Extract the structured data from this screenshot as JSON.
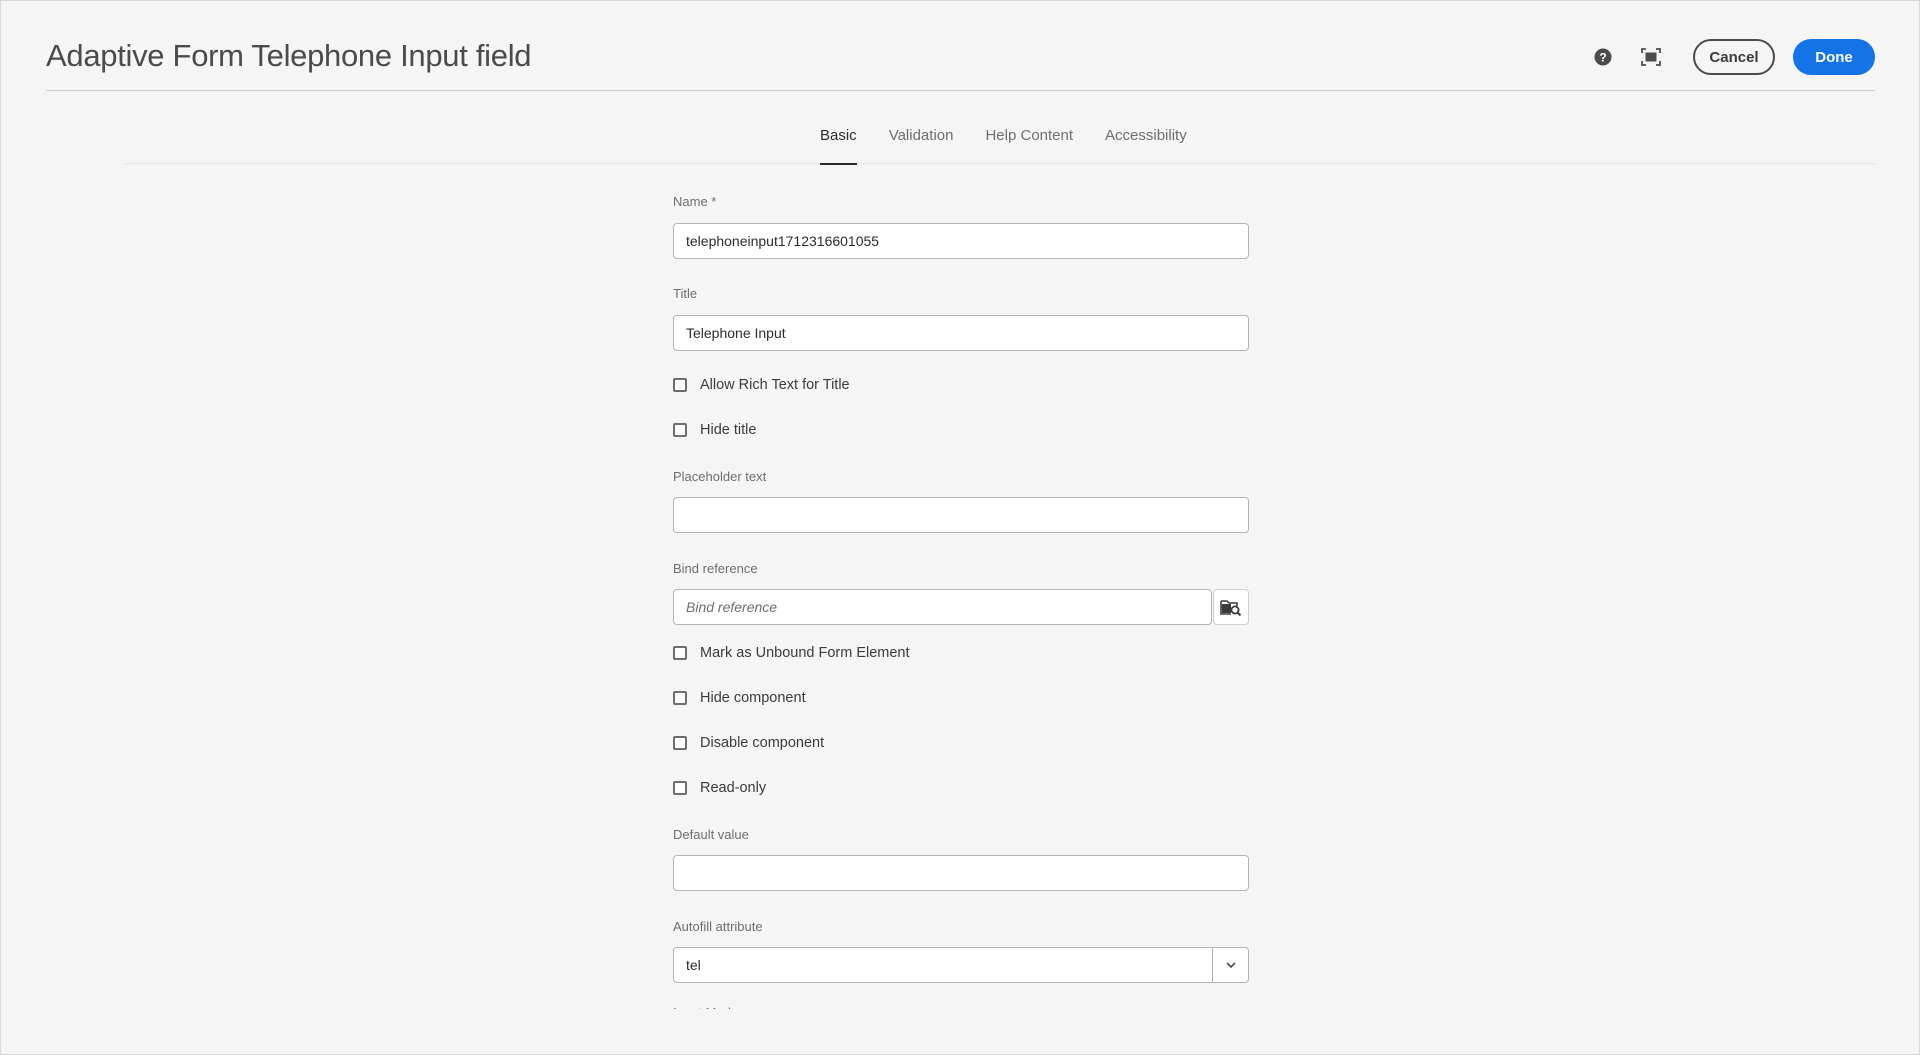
{
  "dialog": {
    "title": "Adaptive Form Telephone Input field",
    "actions": {
      "help_icon": "help-circle-icon",
      "fullscreen_icon": "fullscreen-icon",
      "cancel_label": "Cancel",
      "done_label": "Done"
    }
  },
  "tabs": [
    {
      "label": "Basic",
      "active": true
    },
    {
      "label": "Validation",
      "active": false
    },
    {
      "label": "Help Content",
      "active": false
    },
    {
      "label": "Accessibility",
      "active": false
    }
  ],
  "form": {
    "name": {
      "label": "Name *",
      "value": "telephoneinput1712316601055"
    },
    "title": {
      "label": "Title",
      "value": "Telephone Input"
    },
    "allow_rich_text": {
      "label": "Allow Rich Text for Title",
      "checked": false
    },
    "hide_title": {
      "label": "Hide title",
      "checked": false
    },
    "placeholder_text": {
      "label": "Placeholder text",
      "value": ""
    },
    "bind_reference": {
      "label": "Bind reference",
      "value": "",
      "placeholder": "Bind reference",
      "browse_icon": "folder-search-icon"
    },
    "mark_unbound": {
      "label": "Mark as Unbound Form Element",
      "checked": false
    },
    "hide_component": {
      "label": "Hide component",
      "checked": false
    },
    "disable_component": {
      "label": "Disable component",
      "checked": false
    },
    "read_only": {
      "label": "Read-only",
      "checked": false
    },
    "default_value": {
      "label": "Default value",
      "value": ""
    },
    "autofill": {
      "label": "Autofill attribute",
      "value": "tel",
      "chevron_icon": "chevron-down-icon"
    },
    "next_label": "Input Mode"
  },
  "colors": {
    "accent": "#1473e6",
    "background": "#f5f5f5",
    "text": "#2c2c2c",
    "muted": "#6e6e6e"
  }
}
